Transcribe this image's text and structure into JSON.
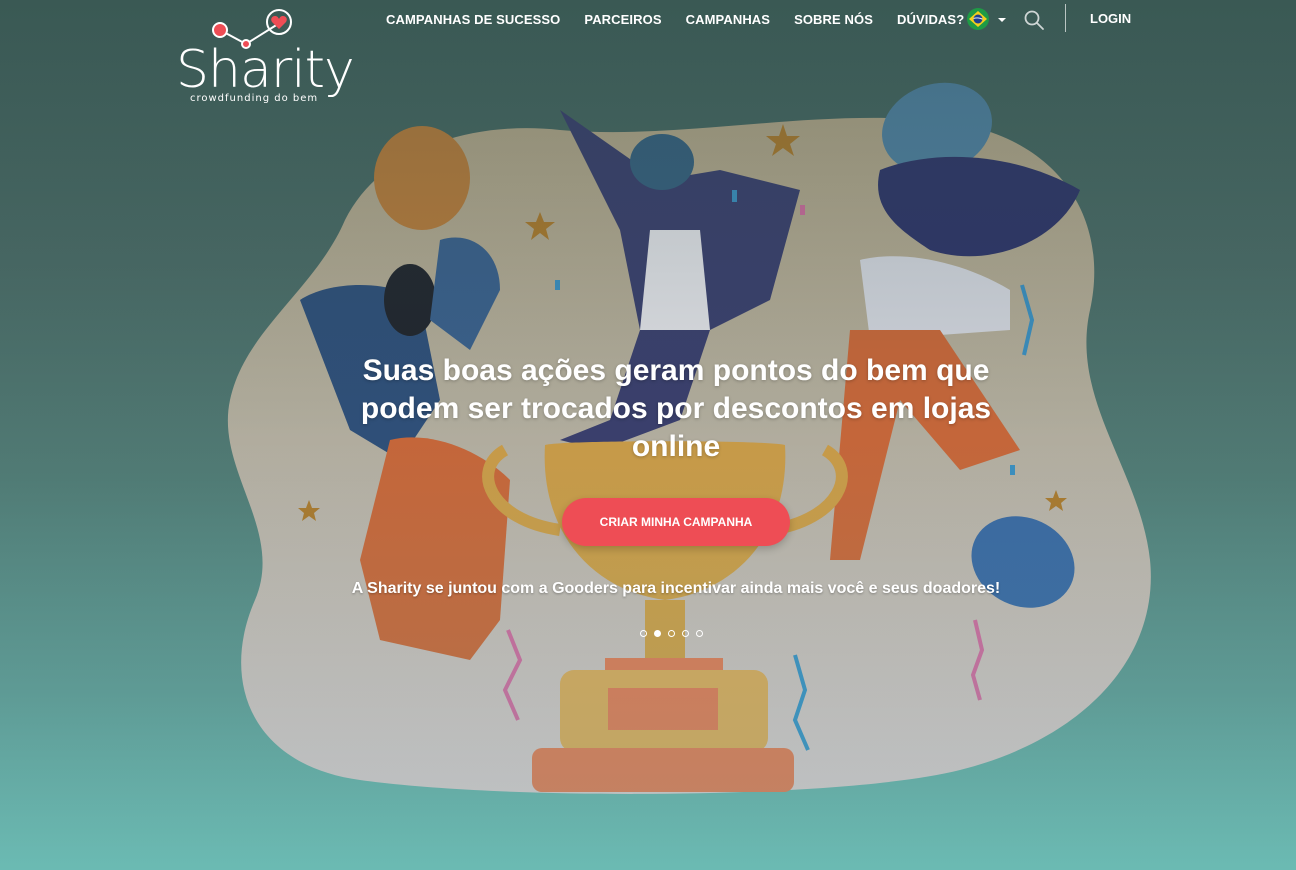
{
  "brand": {
    "name": "Sharity",
    "tagline": "crowdfunding do bem",
    "accent": "#ee4d55"
  },
  "nav": {
    "items": [
      {
        "label": "CAMPANHAS DE SUCESSO"
      },
      {
        "label": "PARCEIROS"
      },
      {
        "label": "CAMPANHAS"
      },
      {
        "label": "SOBRE NÓS"
      },
      {
        "label": "DÚVIDAS?"
      }
    ],
    "language_icon": "brazil-flag-icon",
    "search_icon": "search-icon",
    "login_label": "LOGIN"
  },
  "hero": {
    "headline": "Suas boas ações geram pontos do bem que podem ser trocados por descontos em lojas online",
    "cta_label": "CRIAR MINHA CAMPANHA",
    "subtext": "A Sharity se juntou com a Gooders para incentivar ainda mais você e seus doadores!",
    "slides": {
      "count": 5,
      "active": 2
    }
  }
}
